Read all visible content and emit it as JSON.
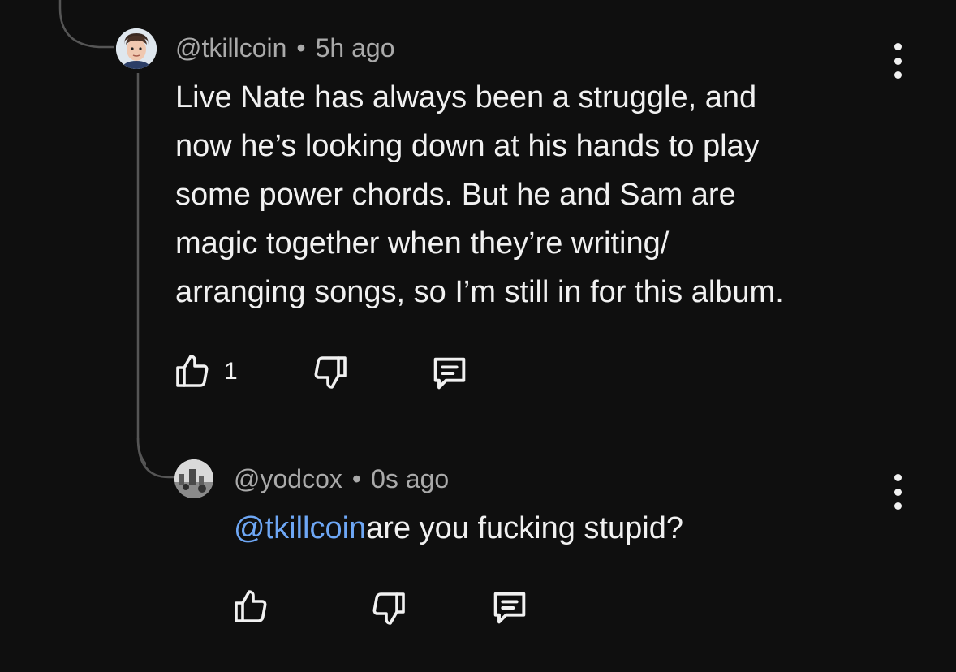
{
  "comment": {
    "author": "@tkillcoin",
    "separator": "•",
    "time": "5h ago",
    "lines": [
      "Live Nate has always been a struggle, and",
      "now he’s looking down at his hands to play",
      "some power chords. But he and Sam are",
      "magic together when they’re writing/",
      "arranging songs, so I’m still in for this album."
    ],
    "like_count": "1",
    "icons": {
      "avatar": "avatar-face-icon",
      "like": "thumbs-up-icon",
      "dislike": "thumbs-down-icon",
      "reply": "reply-comment-icon",
      "more": "more-vertical-icon"
    }
  },
  "reply": {
    "author": "@yodcox",
    "separator": "•",
    "time": "0s ago",
    "mention": "@tkillcoin",
    "text": "are you fucking stupid?",
    "icons": {
      "avatar": "avatar-photo-icon",
      "like": "thumbs-up-icon",
      "dislike": "thumbs-down-icon",
      "reply": "reply-comment-icon",
      "more": "more-vertical-icon"
    }
  },
  "colors": {
    "background": "#0f0f0f",
    "text": "#f1f1f1",
    "meta": "#aaaaaa",
    "mention": "#6ea7f5",
    "thread_line": "#555555"
  }
}
